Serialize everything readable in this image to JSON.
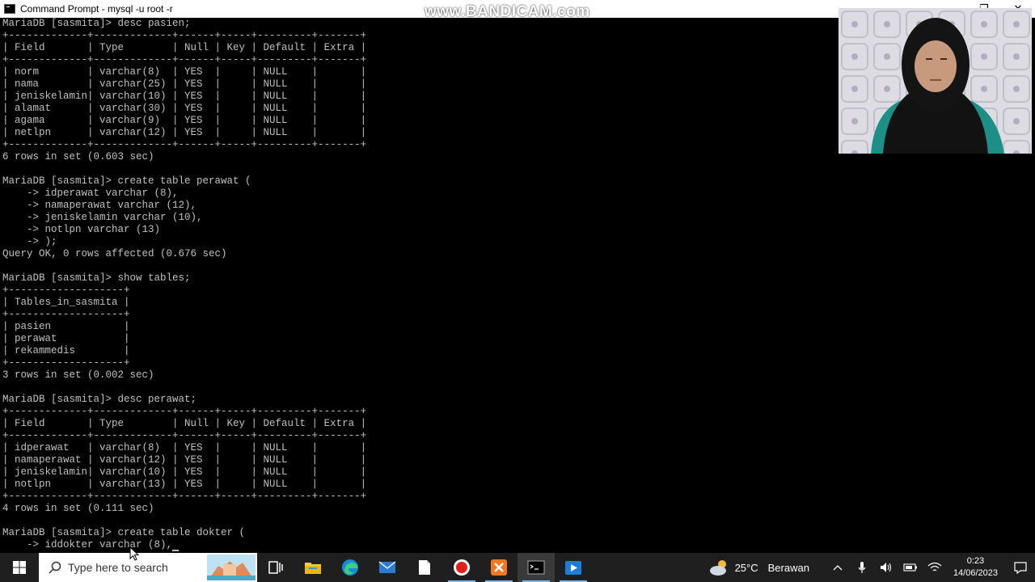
{
  "window": {
    "title": "Command Prompt - mysql  -u root -r",
    "controls": {
      "minimize": "—",
      "maximize": "❐",
      "close": "✕"
    }
  },
  "watermark": "www.BANDICAM.com",
  "terminal": {
    "lines": [
      "MariaDB [sasmita]> desc pasien;",
      "+-------------+-------------+------+-----+---------+-------+",
      "| Field       | Type        | Null | Key | Default | Extra |",
      "+-------------+-------------+------+-----+---------+-------+",
      "| norm        | varchar(8)  | YES  |     | NULL    |       |",
      "| nama        | varchar(25) | YES  |     | NULL    |       |",
      "| jeniskelamin| varchar(10) | YES  |     | NULL    |       |",
      "| alamat      | varchar(30) | YES  |     | NULL    |       |",
      "| agama       | varchar(9)  | YES  |     | NULL    |       |",
      "| netlpn      | varchar(12) | YES  |     | NULL    |       |",
      "+-------------+-------------+------+-----+---------+-------+",
      "6 rows in set (0.603 sec)",
      "",
      "MariaDB [sasmita]> create table perawat (",
      "    -> idperawat varchar (8),",
      "    -> namaperawat varchar (12),",
      "    -> jeniskelamin varchar (10),",
      "    -> notlpn varchar (13)",
      "    -> );",
      "Query OK, 0 rows affected (0.676 sec)",
      "",
      "MariaDB [sasmita]> show tables;",
      "+-------------------+",
      "| Tables_in_sasmita |",
      "+-------------------+",
      "| pasien            |",
      "| perawat           |",
      "| rekammedis        |",
      "+-------------------+",
      "3 rows in set (0.002 sec)",
      "",
      "MariaDB [sasmita]> desc perawat;",
      "+-------------+-------------+------+-----+---------+-------+",
      "| Field       | Type        | Null | Key | Default | Extra |",
      "+-------------+-------------+------+-----+---------+-------+",
      "| idperawat   | varchar(8)  | YES  |     | NULL    |       |",
      "| namaperawat | varchar(12) | YES  |     | NULL    |       |",
      "| jeniskelamin| varchar(10) | YES  |     | NULL    |       |",
      "| notlpn      | varchar(13) | YES  |     | NULL    |       |",
      "+-------------+-------------+------+-----+---------+-------+",
      "4 rows in set (0.111 sec)",
      "",
      "MariaDB [sasmita]> create table dokter (",
      "    -> iddokter varchar (8),"
    ]
  },
  "taskbar": {
    "search_placeholder": "Type here to search",
    "apps": [
      "task-view",
      "file-explorer",
      "edge",
      "mail",
      "notepad",
      "recorder",
      "xampp",
      "command-prompt",
      "media-player"
    ],
    "weather": {
      "temp": "25°C",
      "condition": "Berawan"
    },
    "clock": {
      "time": "0:23",
      "date": "14/06/2023"
    }
  },
  "colors": {
    "terminal_bg": "#000000",
    "terminal_fg": "#c0c0c0",
    "taskbar_bg": "#1f1f1f",
    "accent": "#76b9ed"
  }
}
